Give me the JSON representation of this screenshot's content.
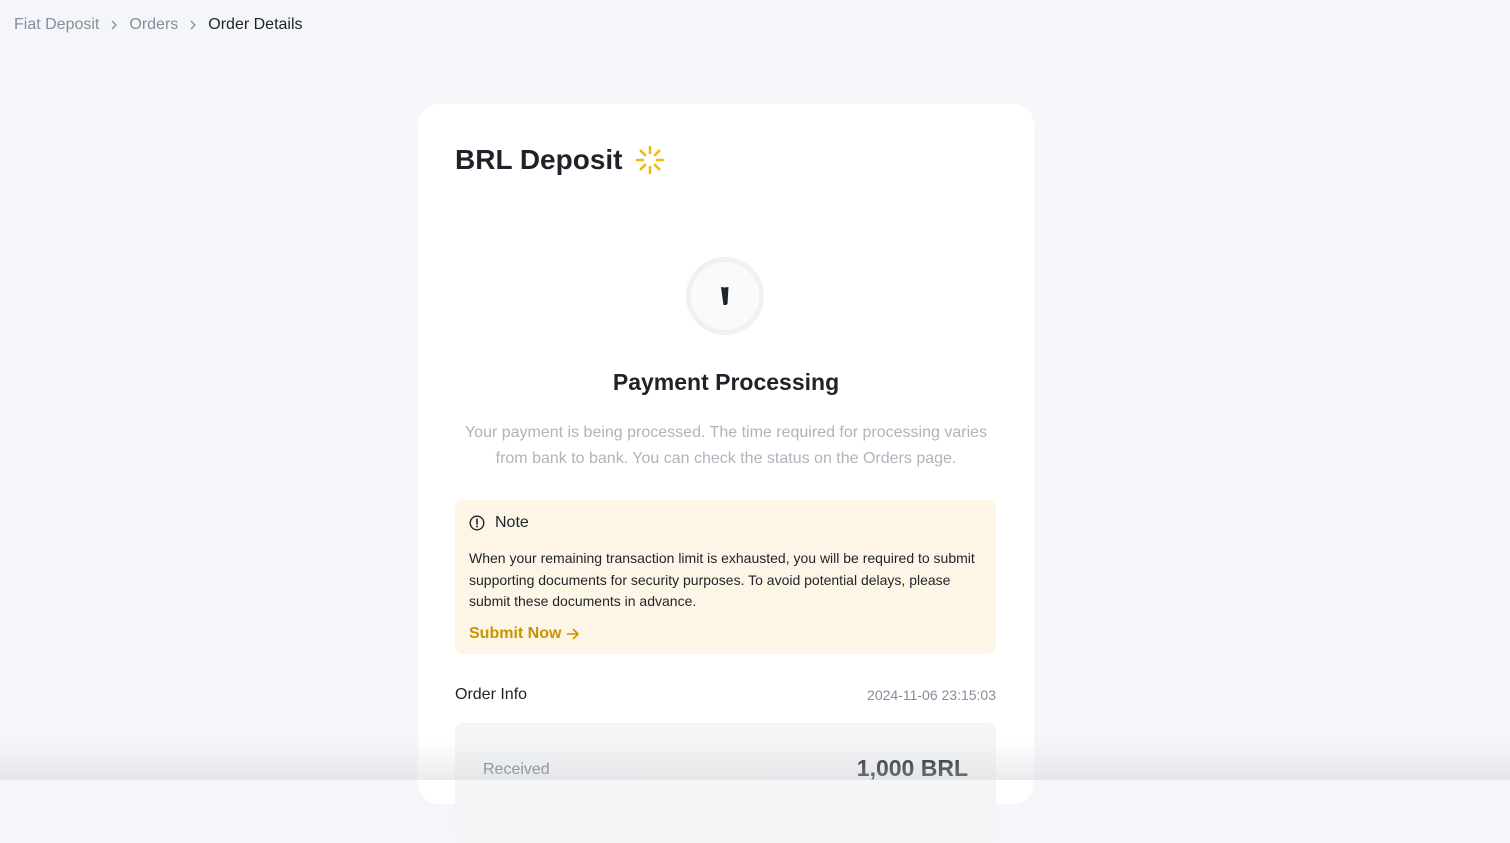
{
  "breadcrumb": {
    "items": [
      {
        "label": "Fiat Deposit"
      },
      {
        "label": "Orders"
      },
      {
        "label": "Order Details"
      }
    ]
  },
  "card": {
    "title": "BRL Deposit",
    "title_icon": "loading-sparkle-icon",
    "status_icon": "clock-icon",
    "status_title": "Payment Processing",
    "status_desc": "Your payment is being processed. The time required for processing varies from bank to bank. You can check the status on the Orders page."
  },
  "note": {
    "icon": "info-icon",
    "heading": "Note",
    "body": "When your remaining transaction limit is exhausted, you will be required to submit supporting documents for security purposes. To avoid potential delays, please submit these documents in advance.",
    "link_label": "Submit Now",
    "link_icon": "arrow-right-icon"
  },
  "order_info": {
    "label": "Order Info",
    "timestamp": "2024-11-06 23:15:03",
    "received_label": "Received",
    "received_value": "1,000 BRL"
  },
  "colors": {
    "accent": "#c99400",
    "note_bg": "#fdf5e6",
    "spinner": "#f0b90b",
    "page_bg": "#f5f6fa"
  }
}
